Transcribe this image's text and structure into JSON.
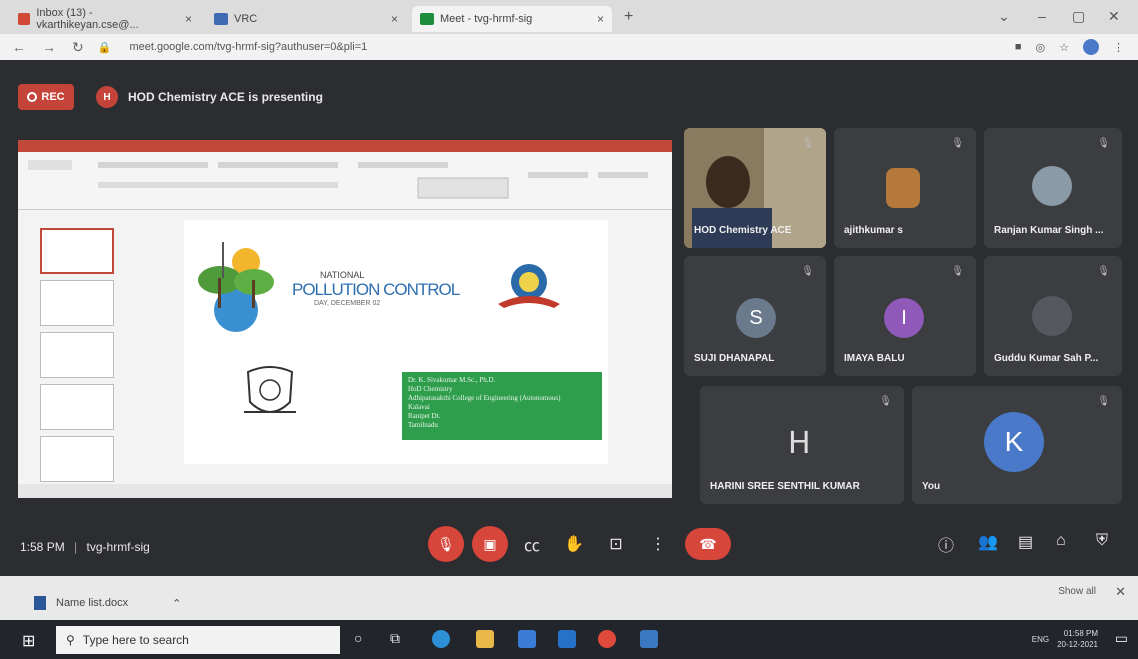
{
  "browser": {
    "tabs": [
      {
        "label": "Inbox (13) - vkarthikeyan.cse@..."
      },
      {
        "label": "VRC"
      },
      {
        "label": "Meet - tvg-hrmf-sig"
      }
    ],
    "new_tab": "+",
    "url": "meet.google.com/tvg-hrmf-sig?authuser=0&pli=1"
  },
  "meet": {
    "rec_label": "REC",
    "presenter_initial": "H",
    "presenter_text": "HOD Chemistry ACE is presenting",
    "slide": {
      "nat": "NATIONAL",
      "title": "POLLUTION CONTROL",
      "day": "DAY, DECEMBER 02",
      "green_lines": [
        "Dr. K. Sivakumar M.Sc., Ph.D.",
        "HoD Chemistry",
        "Adhiparasakthi College of Engineering (Autonomous)",
        "Kalavai",
        "Ranipet Dt.",
        "Tamilnadu"
      ]
    },
    "participants": [
      {
        "name": "HOD Chemistry ACE"
      },
      {
        "name": "ajithkumar s"
      },
      {
        "name": "Ranjan Kumar Singh ..."
      },
      {
        "name": "SUJI DHANAPAL",
        "initial": "S"
      },
      {
        "name": "IMAYA BALU",
        "initial": "I"
      },
      {
        "name": "Guddu Kumar Sah P..."
      },
      {
        "name": "HARINI SREE SENTHIL KUMAR",
        "initial": "H"
      },
      {
        "name": "You",
        "initial": "K"
      }
    ],
    "time": "1:58 PM",
    "meeting_code": "tvg-hrmf-sig"
  },
  "downloads": {
    "file": "Name list.docx",
    "show_all": "Show all"
  },
  "taskbar": {
    "search_placeholder": "Type here to search",
    "lang": "ENG",
    "time": "01:58 PM",
    "date": "20-12-2021"
  },
  "colors": {
    "meet_bg": "#2c2d30",
    "red": "#d7463b",
    "tile": "#3c3d40",
    "avatar_s": "#6a7a8c",
    "avatar_i": "#8e59b8",
    "avatar_k": "#4a79c9"
  }
}
